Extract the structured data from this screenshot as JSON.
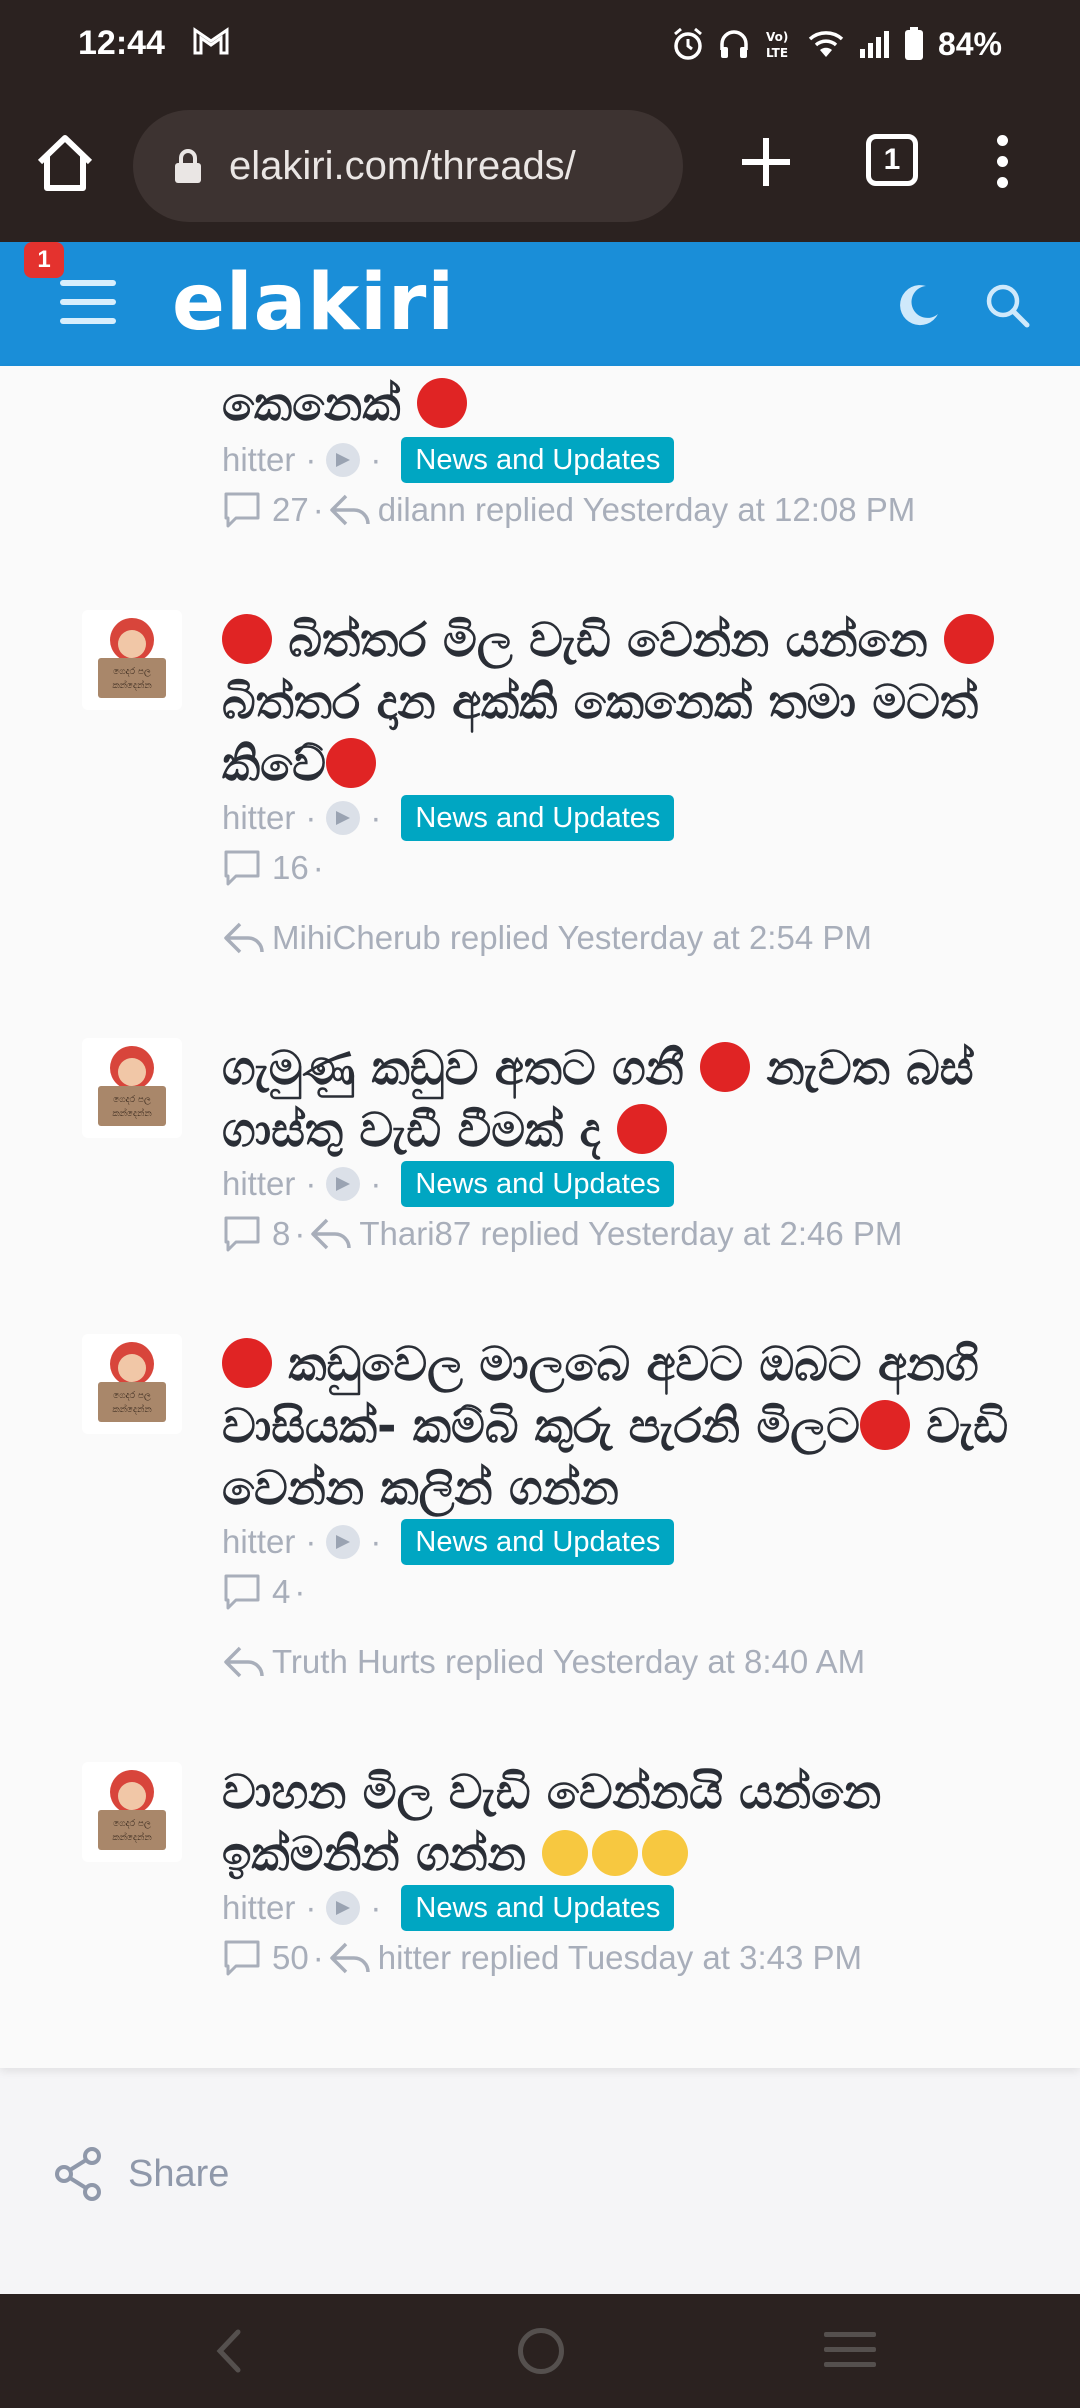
{
  "status_bar": {
    "time": "12:44",
    "battery": "84%"
  },
  "browser": {
    "url": "elakiri.com/threads/",
    "tab_count": "1"
  },
  "site": {
    "logo": "elakiri",
    "notification_count": "1"
  },
  "threads": [
    {
      "title_tail": "කෙනෙක් ",
      "author": "hitter",
      "forum": "News and Updates",
      "replies": "27",
      "last_reply": "dilann replied Yesterday at 12:08 PM"
    },
    {
      "title_parts": [
        " බිත්තර මිල වැඩි වෙන්න යන්නෙ ",
        " බිත්තර දාන අක්කි කෙනෙක් තමා මටත් කිවේ"
      ],
      "author": "hitter",
      "forum": "News and Updates",
      "replies": "16",
      "last_reply": "MihiCherub replied Yesterday at 2:54 PM"
    },
    {
      "title_parts": [
        "ගැමුණු කඩුව අතට ගනී ",
        " නැවත බස් ගාස්තු වැඩී වීමක් ද "
      ],
      "author": "hitter",
      "forum": "News and Updates",
      "replies": "8",
      "last_reply": "Thari87 replied Yesterday at 2:46 PM"
    },
    {
      "title_parts": [
        " කඩුවෙල මාලබෙ අවට ඔබට අනගි වාසියක්- කම්බි කුරු පැරනි මිලට",
        " වැඩි වෙන්න කලින් ගන්න"
      ],
      "author": "hitter",
      "forum": "News and Updates",
      "replies": "4",
      "last_reply": "Truth Hurts replied Yesterday at 8:40 AM"
    },
    {
      "title_parts": [
        "වාහන මිල වැඩි වෙන්නයි යන්නෙ ඉක්මනින් ගන්න "
      ],
      "author": "hitter",
      "forum": "News and Updates",
      "replies": "50",
      "last_reply": "hitter replied Tuesday at 3:43 PM"
    }
  ],
  "avatar_sign_text": "ගෙදර පල කන්දෙන්න",
  "share_label": "Share",
  "meta_separator": "·",
  "colors": {
    "site_blue": "#1a8ed8",
    "tag_teal": "#00a6c2",
    "red_dot": "#e02424",
    "browser_dark": "#2b2220"
  }
}
